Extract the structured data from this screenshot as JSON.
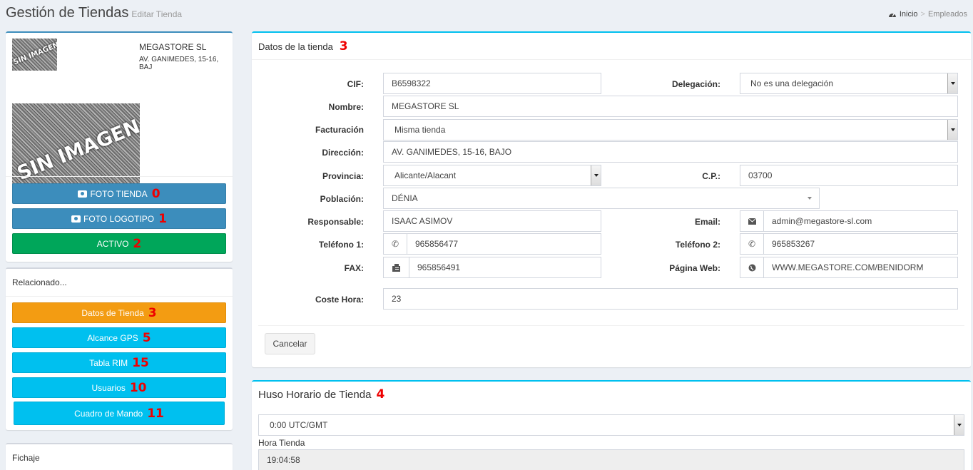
{
  "header": {
    "title": "Gestión de Tiendas",
    "subtitle": "Editar Tienda"
  },
  "breadcrumb": {
    "home": "Inicio",
    "current": "Empleados"
  },
  "profile": {
    "name": "MEGASTORE SL",
    "address": "AV. GANIMEDES, 15-16, BAJ",
    "no_image_text": "SIN IMAGEN",
    "buttons": [
      {
        "label": "FOTO TIENDA",
        "num": "0"
      },
      {
        "label": "FOTO LOGOTIPO",
        "num": "1"
      },
      {
        "label": "ACTIVO",
        "num": "2"
      }
    ]
  },
  "related": {
    "title": "Relacionado...",
    "items": [
      {
        "label": "Datos de Tienda",
        "num": "3"
      },
      {
        "label": "Alcance GPS",
        "num": "5"
      },
      {
        "label": "Tabla RIM",
        "num": "15"
      },
      {
        "label": "Usuarios",
        "num": "10"
      },
      {
        "label": "Cuadro de Mando",
        "num": "11"
      }
    ]
  },
  "fichaje": {
    "title": "Fichaje"
  },
  "store_form": {
    "title": "Datos de la tienda",
    "num": "3",
    "labels": {
      "cif": "CIF:",
      "delegacion": "Delegación:",
      "nombre": "Nombre:",
      "facturacion": "Facturación",
      "direccion": "Dirección:",
      "provincia": "Provincia:",
      "cp": "C.P.:",
      "poblacion": "Población:",
      "responsable": "Responsable:",
      "email": "Email:",
      "telefono1": "Teléfono 1:",
      "telefono2": "Teléfono 2:",
      "fax": "FAX:",
      "web": "Página Web:",
      "coste": "Coste Hora:"
    },
    "values": {
      "cif": "B6598322",
      "delegacion": "No es una delegación",
      "nombre": "MEGASTORE SL",
      "facturacion": "Misma tienda",
      "direccion": "AV. GANIMEDES, 15-16, BAJO",
      "provincia": "Alicante/Alacant",
      "cp": "03700",
      "poblacion": "DÉNIA",
      "responsable": "ISAAC ASIMOV",
      "email": "admin@megastore-sl.com",
      "telefono1": "965856477",
      "telefono2": "965853267",
      "fax": "965856491",
      "web": "WWW.MEGASTORE.COM/BENIDORM",
      "coste": "23"
    },
    "cancel_label": "Cancelar"
  },
  "timezone": {
    "title": "Huso Horario de Tienda",
    "num": "4",
    "zone": "0:00 UTC/GMT",
    "hora_label": "Hora Tienda",
    "hora_value": "19:04:58"
  }
}
